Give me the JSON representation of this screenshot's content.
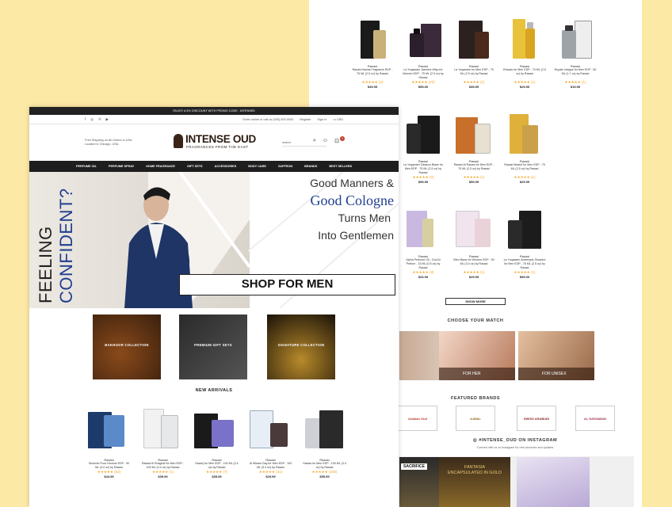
{
  "front": {
    "topbar": "ENJOY A 5% DISCOUNT WITH PROMO CODE : INTENSE5",
    "social_icons": [
      "facebook-icon",
      "instagram-icon",
      "pinterest-icon",
      "youtube-icon"
    ],
    "util": {
      "order": "Order online or call us (000) 000-0000",
      "register": "Register",
      "signin": "Sign In",
      "currency": "USD"
    },
    "freeship": "Free Shipping on All Orders in USA Located in Chicago, USA",
    "logo": {
      "title": "INTENSE OUD",
      "subtitle": "FRAGRANCES FROM THE EAST"
    },
    "search_placeholder": "search",
    "cart_count": "0",
    "nav": [
      "PERFUME OIL",
      "PERFUME SPRAY",
      "HOME FRAGRANCE",
      "GIFT SETS",
      "ACCESSORIES",
      "BODY CARE",
      "ZAFFRON",
      "BRANDS",
      "BEST SELLERS"
    ],
    "hero": {
      "feeling": "FEELING",
      "confident": "CONFIDENT?",
      "line1": "Good Manners &",
      "line2": "Good Cologne",
      "line3": "Turns Men",
      "line4": "Into Gentlemen",
      "button": "SHOP FOR MEN"
    },
    "collections": [
      "BAKHOOR COLLECTION",
      "PREMIUM GIFT SETS",
      "SIGNATURE COLLECTION"
    ],
    "new_arrivals_title": "NEW ARRIVALS",
    "new_arrivals": [
      {
        "brand": "Rasasi",
        "name": "Shuhrah Pour Homme EDP - 90 ML (3.0 oz) by Rasasi",
        "reviews": "(62)",
        "price": "$44.99"
      },
      {
        "brand": "Rasasi",
        "name": "Rasasi Al Shaghaf for Men EDP - 100 ML (3.4 oz) by Rasasi",
        "reviews": "(1)",
        "price": "$39.99"
      },
      {
        "brand": "Rasasi",
        "name": "Daarej for Men EDP - 100 ML (3.4 oz) by Rasasi",
        "reviews": "(7)",
        "price": "$35.99"
      },
      {
        "brand": "Rasasi",
        "name": "Al Wisam Day for Men EDP - 100 ML (3.4 oz) by Rasasi",
        "reviews": "(41)",
        "price": "$29.99"
      },
      {
        "brand": "Rasasi",
        "name": "Hawas for Men EDP - 100 ML (3.4 oz) by Rasasi",
        "reviews": "(346)",
        "price": "$55.99"
      }
    ]
  },
  "back": {
    "row1": [
      {
        "brand": "Rasasi",
        "name": "Rasasi Hawas Fragrance EDP - 75 ML (2.5 oz) by Rasasi",
        "reviews": "(4)",
        "price": "$49.99"
      },
      {
        "brand": "Rasasi",
        "name": "La Yuqawam Jasmine Wisp for Women EDP - 75 ML (2.5 oz) by Rasasi",
        "reviews": "(20)",
        "price": "$55.00"
      },
      {
        "brand": "Rasasi",
        "name": "La Yuqawam for Men EDP - 75 ML (2.5 oz) by Rasasi",
        "reviews": "(1)",
        "price": "$35.99"
      },
      {
        "brand": "Rasasi",
        "name": "Ehsaas for Men EDP - 75 ML (2.5 oz) by Rasasi",
        "reviews": "(1)",
        "price": "$29.99"
      },
      {
        "brand": "Rasasi",
        "name": "Royale Intrigue for Men EDP - 50 ML (1.7 oz) by Rasasi",
        "reviews": "(1)",
        "price": "$19.99"
      }
    ],
    "row2": [
      {
        "brand": "Rasasi",
        "name": "Rasasi Al Wisam Day Deluxe Pour La Men EDP - 100 ML (3.4 oz) by Rasasi",
        "reviews": "(15)",
        "price": "$40.99"
      },
      {
        "brand": "Rasasi",
        "name": "La Yuqawam Tobacco Blaze for Men EDP - 75 ML (2.5 oz) by Rasasi",
        "reviews": "(0)",
        "price": "$59.99"
      },
      {
        "brand": "Rasasi",
        "name": "Rasasi Al Rasasi for Men EDP - 75 ML (2.5 oz) by Rasasi",
        "reviews": "(1)",
        "price": "$59.99"
      },
      {
        "brand": "Rasasi",
        "name": "Rasasi Maaluf for Men EDP - 75 ML (2.5 oz) by Rasasi",
        "reviews": "(1)",
        "price": "$29.99"
      }
    ],
    "row3": [
      {
        "brand": "Rasasi",
        "name": "Egra for Men EDP - 100 ML (3.4 oz) by Rasasi",
        "reviews": "(1)",
        "price": "$33.00"
      },
      {
        "brand": "Rasasi",
        "name": "Alpha Perfume Oil - Oud Al Perfum - 15 ML (0.5 oz) by Rasasi",
        "reviews": "(3)",
        "price": "$33.99"
      },
      {
        "brand": "Rasasi",
        "name": "Bleu Blanc for Women EDP - 90 ML (3.0 oz) by Rasasi",
        "reviews": "(1)",
        "price": "$29.99"
      },
      {
        "brand": "Rasasi",
        "name": "La Yuqawam Ambergris Showers for Men EDP - 75 ML (2.5 oz) by Rasasi",
        "reviews": "(1)",
        "price": "$59.00"
      }
    ],
    "show_more": "SHOW MORE",
    "choose_title": "CHOOSE YOUR MATCH",
    "matches": [
      "FOR HER",
      "FOR UNISEX"
    ],
    "featured_title": "FEATURED BRANDS",
    "brands": [
      "Arabian Oud",
      "AJMAL",
      "SWISS ARABIAN",
      "AL HARAMAIN"
    ],
    "insta_title": "#INTENSE_OUD ON INSTAGRAM",
    "insta_sub": "Connect with us on Instagram for new launches and updates",
    "insta_tiles": [
      "SACRIFICE",
      "FANTASIA ENCAPSULATED IN GOLD",
      ""
    ]
  },
  "colors": {
    "background": "#fde9a6",
    "accent_blue": "#1f3f8f",
    "nav_bg": "#1e1e1e",
    "star": "#f5a623"
  }
}
